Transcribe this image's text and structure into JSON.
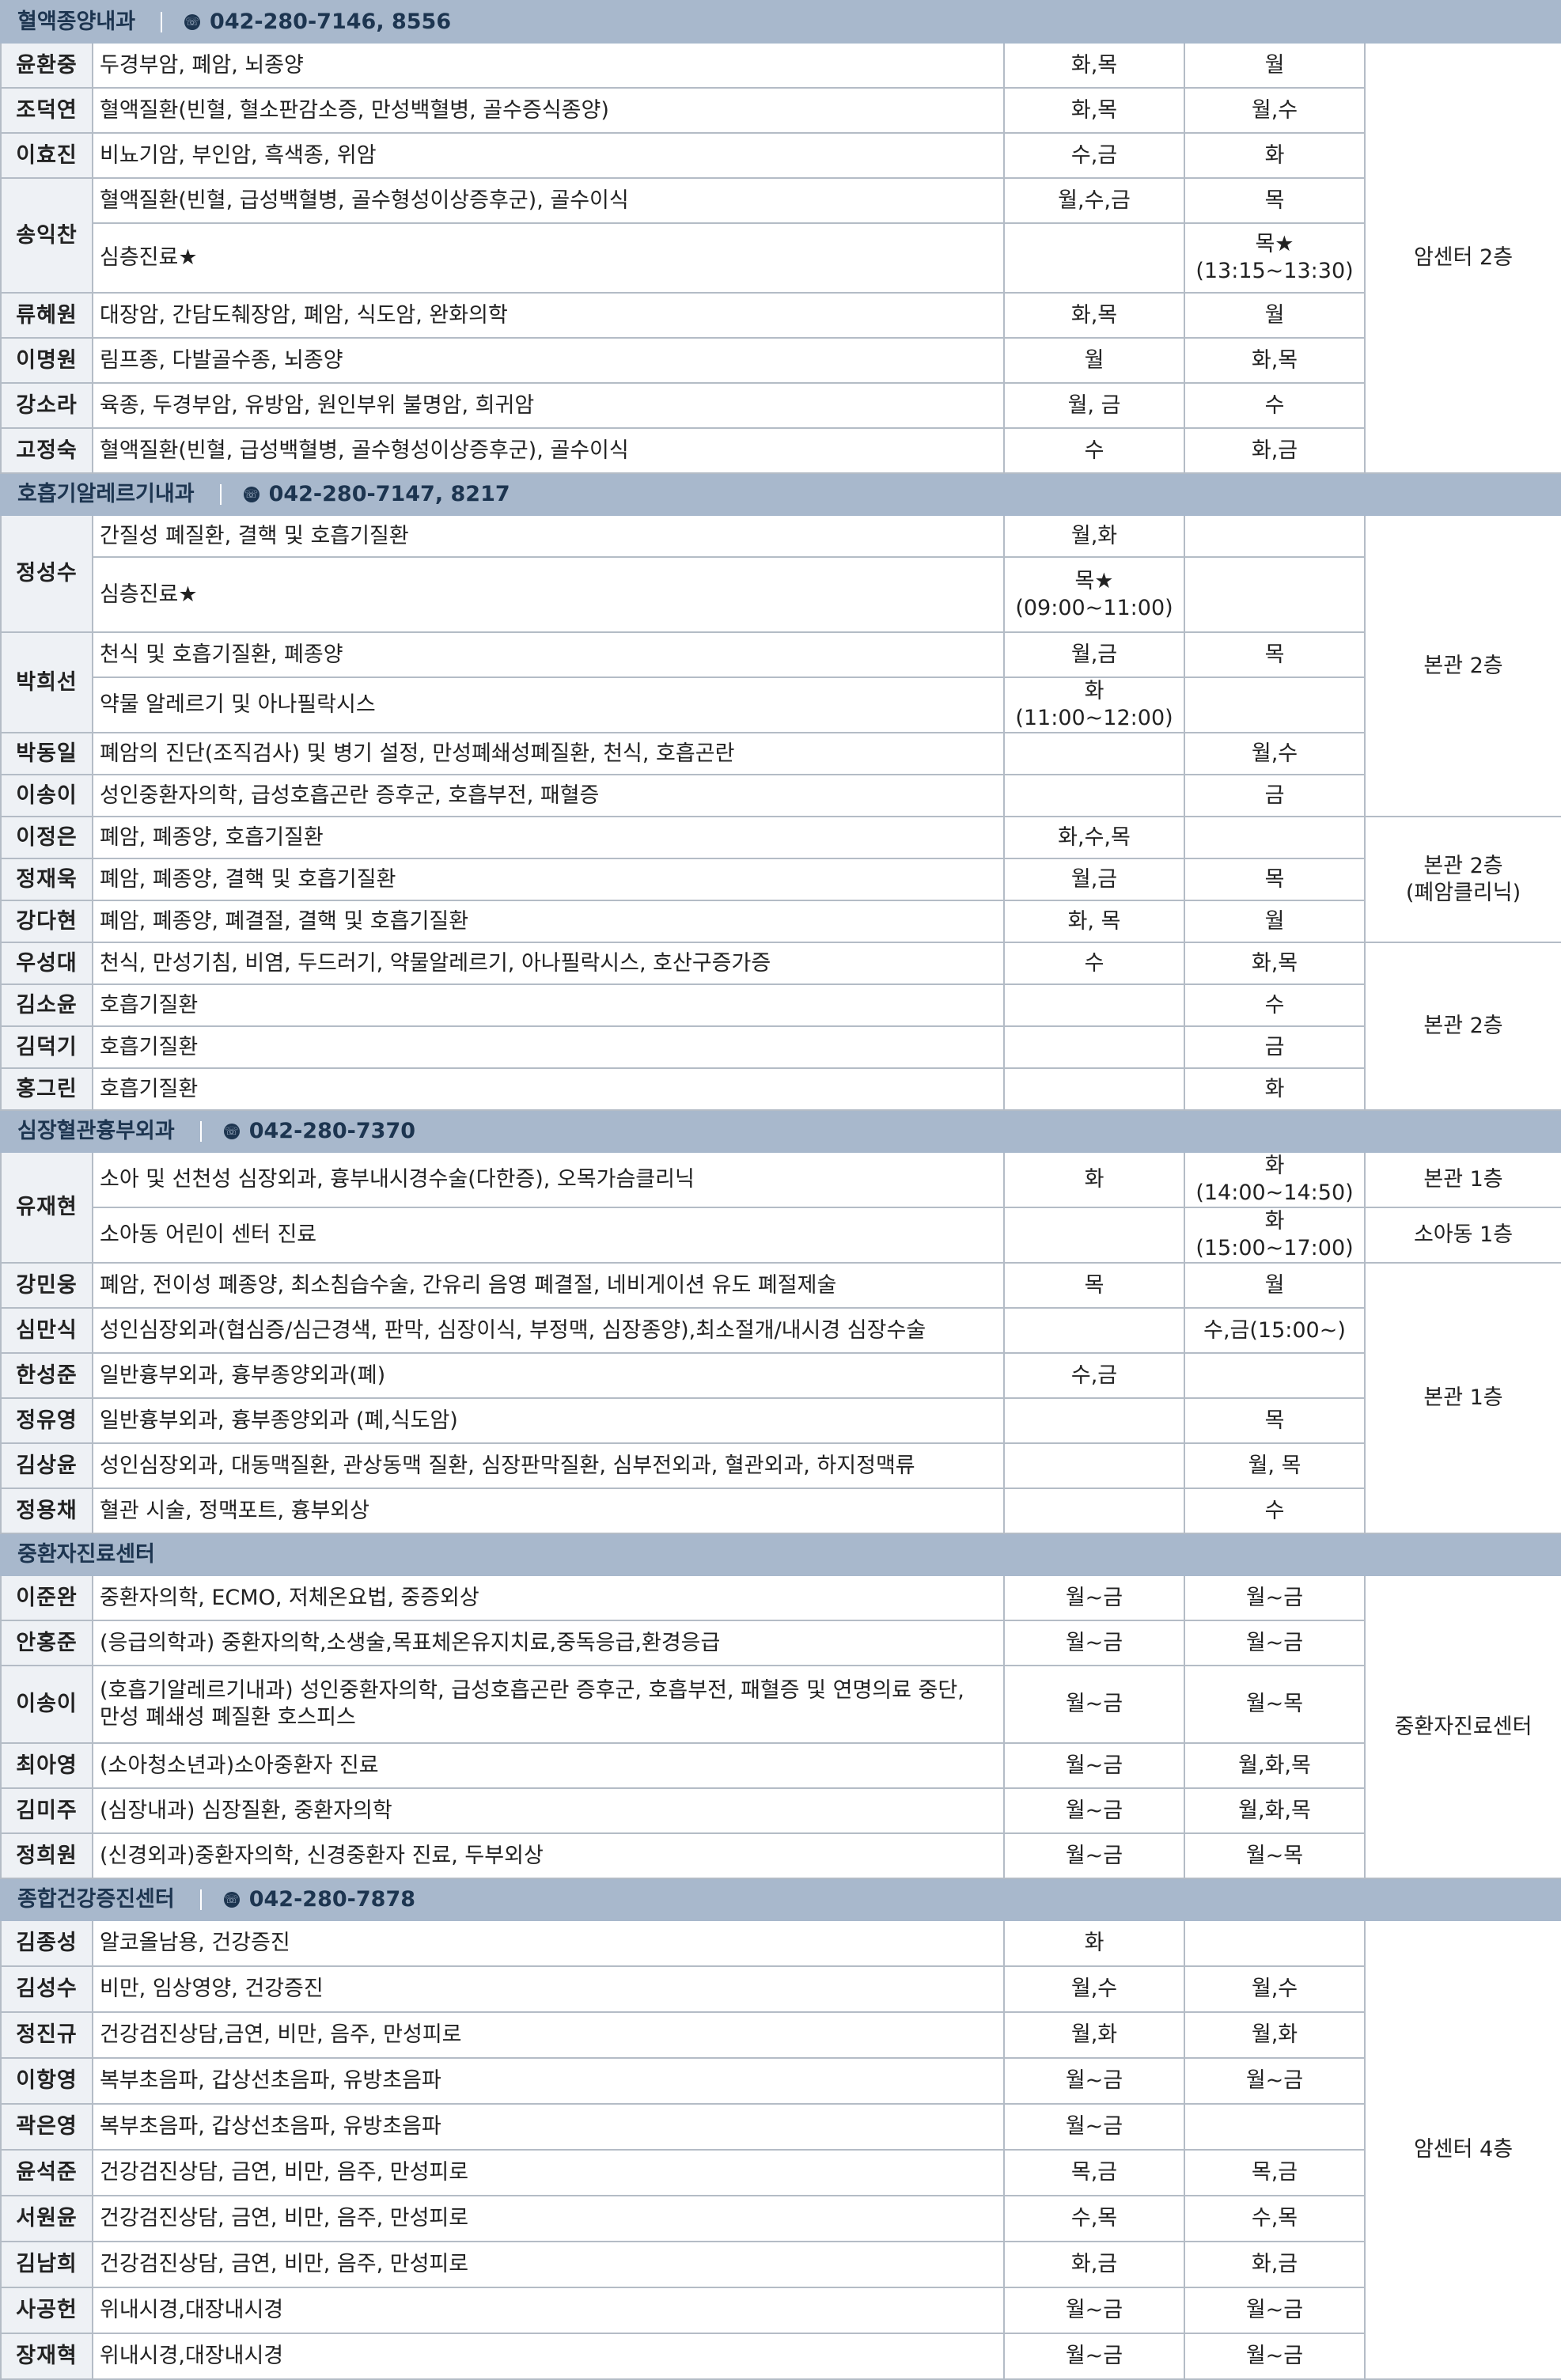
{
  "sections": [
    {
      "title": "혈액종양내과",
      "phone": "042-280-7146, 8556",
      "rows": [
        {
          "name": "윤환중",
          "specialty": "두경부암, 폐암, 뇌종양",
          "am": "화,목",
          "pm": "월"
        },
        {
          "name": "조덕연",
          "specialty": "혈액질환(빈혈, 혈소판감소증, 만성백혈병, 골수증식종양)",
          "am": "화,목",
          "pm": "월,수"
        },
        {
          "name": "이효진",
          "specialty": "비뇨기암, 부인암, 흑색종, 위암",
          "am": "수,금",
          "pm": "화"
        },
        {
          "name": "송익찬",
          "specialty": "혈액질환(빈혈, 급성백혈병, 골수형성이상증후군), 골수이식",
          "am": "월,수,금",
          "pm": "목"
        },
        {
          "name": "",
          "specialty": "심층진료★",
          "am": "",
          "pm": "목★",
          "pm_note": "(13:15~13:30)"
        },
        {
          "name": "류혜원",
          "specialty": "대장암, 간담도췌장암, 폐암, 식도암, 완화의학",
          "am": "화,목",
          "pm": "월"
        },
        {
          "name": "이명원",
          "specialty": "림프종, 다발골수종, 뇌종양",
          "am": "월",
          "pm": "화,목"
        },
        {
          "name": "강소라",
          "specialty": "육종, 두경부암, 유방암, 원인부위 불명암, 희귀암",
          "am": "월, 금",
          "pm": "수"
        },
        {
          "name": "고정숙",
          "specialty": "혈액질환(빈혈, 급성백혈병, 골수형성이상증후군), 골수이식",
          "am": "수",
          "pm": "화,금"
        }
      ],
      "locations": [
        "암센터 2층"
      ]
    },
    {
      "title": "호흡기알레르기내과",
      "phone": "042-280-7147, 8217",
      "rows": [
        {
          "name": "정성수",
          "specialty": "간질성 폐질환, 결핵 및 호흡기질환",
          "am": "월,화",
          "pm": ""
        },
        {
          "name": "",
          "specialty": "심층진료★",
          "am": "목★",
          "am_note": "(09:00~11:00)",
          "pm": ""
        },
        {
          "name": "박희선",
          "specialty": "천식 및 호흡기질환, 폐종양",
          "am": "월,금",
          "pm": "목"
        },
        {
          "name": "",
          "specialty": "약물 알레르기 및 아나필락시스",
          "am": "화(11:00~12:00)",
          "pm": ""
        },
        {
          "name": "박동일",
          "specialty": "폐암의 진단(조직검사) 및 병기 설정, 만성폐쇄성폐질환, 천식, 호흡곤란",
          "am": "",
          "pm": "월,수"
        },
        {
          "name": "이송이",
          "specialty": "성인중환자의학, 급성호흡곤란 증후군, 호흡부전, 패혈증",
          "am": "",
          "pm": "금"
        },
        {
          "name": "이정은",
          "specialty": "폐암, 폐종양, 호흡기질환",
          "am": "화,수,목",
          "pm": ""
        },
        {
          "name": "정재욱",
          "specialty": "폐암, 폐종양, 결핵 및 호흡기질환",
          "am": "월,금",
          "pm": "목"
        },
        {
          "name": "강다현",
          "specialty": "폐암, 폐종양, 폐결절, 결핵 및 호흡기질환",
          "am": "화, 목",
          "pm": "월"
        },
        {
          "name": "우성대",
          "specialty": "천식, 만성기침, 비염, 두드러기, 약물알레르기, 아나필락시스, 호산구증가증",
          "am": "수",
          "pm": "화,목"
        },
        {
          "name": "김소윤",
          "specialty": "호흡기질환",
          "am": "",
          "pm": "수"
        },
        {
          "name": "김덕기",
          "specialty": "호흡기질환",
          "am": "",
          "pm": "금"
        },
        {
          "name": "홍그린",
          "specialty": "호흡기질환",
          "am": "",
          "pm": "화"
        }
      ],
      "locations": [
        "본관 2층",
        "본관 2층",
        "(폐암클리닉)",
        "본관 2층"
      ]
    },
    {
      "title": "심장혈관흉부외과",
      "phone": "042-280-7370",
      "rows": [
        {
          "name": "유재현",
          "specialty": "소아 및 선천성 심장외과, 흉부내시경수술(다한증), 오목가슴클리닉",
          "am": "화",
          "pm": "화(14:00~14:50)"
        },
        {
          "name": "",
          "specialty": "소아동 어린이 센터 진료",
          "am": "",
          "pm": "화(15:00~17:00)"
        },
        {
          "name": "강민웅",
          "specialty": "폐암, 전이성 폐종양, 최소침습수술, 간유리 음영 폐결절, 네비게이션 유도 폐절제술",
          "am": "목",
          "pm": "월"
        },
        {
          "name": "심만식",
          "specialty": "성인심장외과(협심증/심근경색, 판막, 심장이식, 부정맥, 심장종양),최소절개/내시경 심장수술",
          "am": "",
          "pm": "수,금(15:00~)"
        },
        {
          "name": "한성준",
          "specialty": "일반흉부외과, 흉부종양외과(폐)",
          "am": "수,금",
          "pm": ""
        },
        {
          "name": "정유영",
          "specialty": "일반흉부외과, 흉부종양외과 (폐,식도암)",
          "am": "",
          "pm": "목"
        },
        {
          "name": "김상윤",
          "specialty": "성인심장외과, 대동맥질환, 관상동맥 질환, 심장판막질환, 심부전외과, 혈관외과, 하지정맥류",
          "am": "",
          "pm": "월, 목"
        },
        {
          "name": "정용채",
          "specialty": "혈관 시술, 정맥포트, 흉부외상",
          "am": "",
          "pm": "수"
        }
      ],
      "locations": [
        "본관 1층",
        "소아동 1층",
        "본관 1층"
      ]
    },
    {
      "title": "중환자진료센터",
      "phone": "",
      "rows": [
        {
          "name": "이준완",
          "specialty": "중환자의학, ECMO, 저체온요법, 중증외상",
          "am": "월~금",
          "pm": "월~금"
        },
        {
          "name": "안홍준",
          "specialty": "(응급의학과) 중환자의학,소생술,목표체온유지치료,중독응급,환경응급",
          "am": "월~금",
          "pm": "월~금"
        },
        {
          "name": "이송이",
          "specialty": "(호흡기알레르기내과) 성인중환자의학, 급성호흡곤란 증후군, 호흡부전, 패혈증 및 연명의료 중단,",
          "specialty2": "만성 폐쇄성 폐질환 호스피스",
          "am": "월~금",
          "pm": "월~목"
        },
        {
          "name": "최아영",
          "specialty": "(소아청소년과)소아중환자 진료",
          "am": "월~금",
          "pm": "월,화,목"
        },
        {
          "name": "김미주",
          "specialty": "(심장내과) 심장질환, 중환자의학",
          "am": "월~금",
          "pm": "월,화,목"
        },
        {
          "name": "정희원",
          "specialty": "(신경외과)중환자의학, 신경중환자 진료, 두부외상",
          "am": "월~금",
          "pm": "월~목"
        }
      ],
      "locations": [
        "중환자진료센터"
      ]
    },
    {
      "title": "종합건강증진센터",
      "phone": "042-280-7878",
      "rows": [
        {
          "name": "김종성",
          "specialty": "알코올남용, 건강증진",
          "am": "화",
          "pm": ""
        },
        {
          "name": "김성수",
          "specialty": "비만, 임상영양, 건강증진",
          "am": "월,수",
          "pm": "월,수"
        },
        {
          "name": "정진규",
          "specialty": "건강검진상담,금연, 비만, 음주, 만성피로",
          "am": "월,화",
          "pm": "월,화"
        },
        {
          "name": "이항영",
          "specialty": "복부초음파, 갑상선초음파, 유방초음파",
          "am": "월~금",
          "pm": "월~금"
        },
        {
          "name": "곽은영",
          "specialty": "복부초음파, 갑상선초음파, 유방초음파",
          "am": "월~금",
          "pm": ""
        },
        {
          "name": "윤석준",
          "specialty": "건강검진상담, 금연, 비만, 음주, 만성피로",
          "am": "목,금",
          "pm": "목,금"
        },
        {
          "name": "서원윤",
          "specialty": "건강검진상담, 금연, 비만, 음주, 만성피로",
          "am": "수,목",
          "pm": "수,목"
        },
        {
          "name": "김남희",
          "specialty": "건강검진상담, 금연, 비만, 음주, 만성피로",
          "am": "화,금",
          "pm": "화,금"
        },
        {
          "name": "사공헌",
          "specialty": "위내시경,대장내시경",
          "am": "월~금",
          "pm": "월~금"
        },
        {
          "name": "장재혁",
          "specialty": "위내시경,대장내시경",
          "am": "월~금",
          "pm": "월~금"
        }
      ],
      "locations": [
        "암센터 4층"
      ]
    }
  ]
}
